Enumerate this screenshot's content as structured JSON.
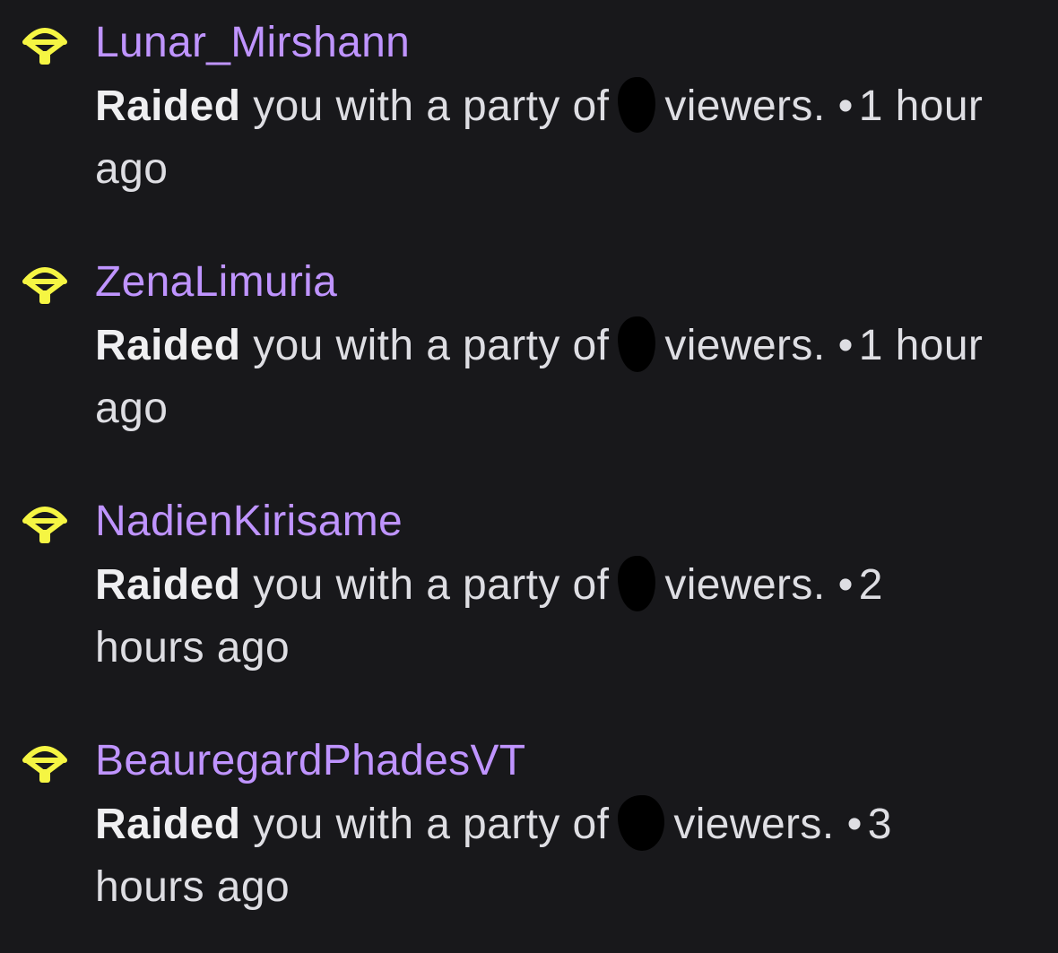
{
  "colors": {
    "background": "#18181b",
    "username": "#bf94ff",
    "icon": "#f5f543",
    "text": "#dedee3"
  },
  "icon_name": "raid-parachute-icon",
  "events": [
    {
      "username": "Lunar_Mirshann",
      "action": "Raided",
      "message_pre": "you with a party of",
      "message_post": "viewers.",
      "separator": "•",
      "time": "1 hour ago"
    },
    {
      "username": "ZenaLimuria",
      "action": "Raided",
      "message_pre": "you with a party of",
      "message_post": "viewers.",
      "separator": "•",
      "time": "1 hour ago"
    },
    {
      "username": "NadienKirisame",
      "action": "Raided",
      "message_pre": "you with a party of",
      "message_post": "viewers.",
      "separator": "•",
      "time": "2 hours ago"
    },
    {
      "username": "BeauregardPhadesVT",
      "action": "Raided",
      "message_pre": "you with a party of",
      "message_post": "viewers.",
      "separator": "•",
      "time": "3 hours ago"
    }
  ]
}
